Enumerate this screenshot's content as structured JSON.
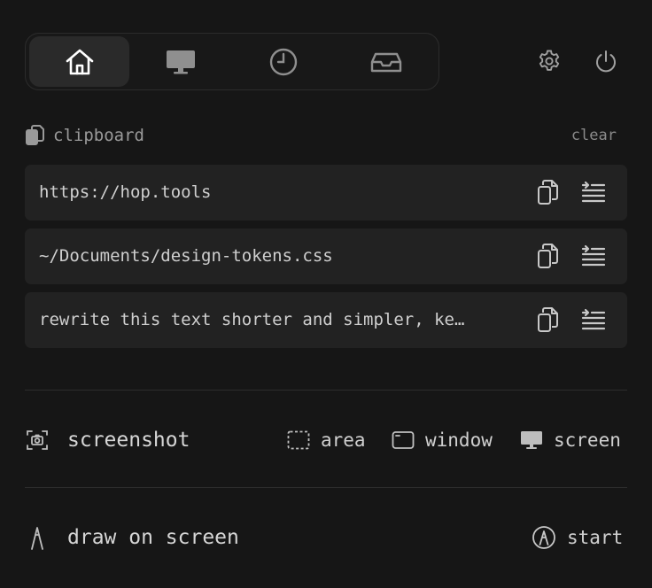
{
  "tabs": [
    {
      "icon": "home-icon",
      "active": true
    },
    {
      "icon": "monitor-icon",
      "active": false
    },
    {
      "icon": "clock-icon",
      "active": false
    },
    {
      "icon": "inbox-icon",
      "active": false
    }
  ],
  "header_icons": [
    "gear-icon",
    "power-icon"
  ],
  "clipboard": {
    "title": "clipboard",
    "clear_label": "clear",
    "items": [
      {
        "text": "https://hop.tools"
      },
      {
        "text": "~/Documents/design-tokens.css"
      },
      {
        "text": "rewrite this text shorter and simpler, ke…"
      }
    ]
  },
  "screenshot": {
    "label": "screenshot",
    "options": {
      "area": "area",
      "window": "window",
      "screen": "screen"
    }
  },
  "draw": {
    "label": "draw on screen",
    "start_label": "start"
  },
  "colors": {
    "background": "#161616",
    "item_background": "#222222",
    "active_tab": "#2a2a2a",
    "text_primary": "#d8d8d8",
    "text_muted": "#9a9a9a"
  }
}
